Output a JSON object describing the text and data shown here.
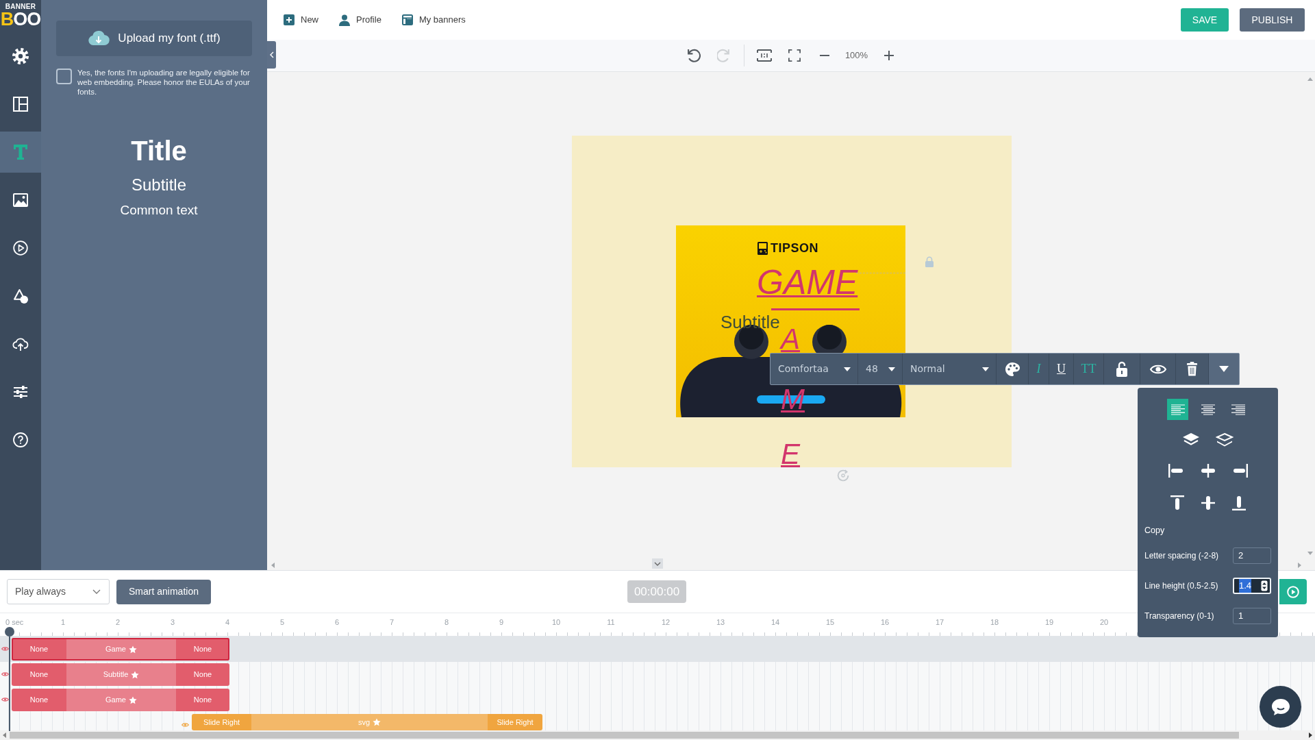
{
  "logo": {
    "top": "BANNER",
    "bottom": "BOO"
  },
  "sidebar": {
    "items": [
      {
        "kind": "settings",
        "selected": false
      },
      {
        "kind": "layout",
        "selected": false
      },
      {
        "kind": "text",
        "selected": true
      },
      {
        "kind": "image",
        "selected": false
      },
      {
        "kind": "video",
        "selected": false
      },
      {
        "kind": "shapes",
        "selected": false
      },
      {
        "kind": "upload",
        "selected": false
      },
      {
        "kind": "adjust",
        "selected": false
      },
      {
        "kind": "help",
        "selected": false
      }
    ]
  },
  "font_panel": {
    "upload_button": "Upload my font (.ttf)",
    "eula": {
      "checked": false,
      "label": "Yes, the fonts I'm uploading are legally eligible for web embedding. Please honor the EULAs of your fonts."
    },
    "presets": [
      {
        "kind": "title",
        "label": "Title"
      },
      {
        "kind": "subtitle",
        "label": "Subtitle"
      },
      {
        "kind": "common",
        "label": "Common text"
      }
    ]
  },
  "top_nav": {
    "links": [
      {
        "kind": "new",
        "label": "New"
      },
      {
        "kind": "profile",
        "label": "Profile"
      },
      {
        "kind": "banners",
        "label": "My banners"
      }
    ],
    "buttons": [
      {
        "kind": "save",
        "label": "SAVE"
      },
      {
        "kind": "publish",
        "label": "PUBLISH"
      }
    ]
  },
  "canvas_toolbar": {
    "history": [
      {
        "kind": "undo",
        "disabled": false
      },
      {
        "kind": "redo",
        "disabled": true
      }
    ],
    "view": [
      {
        "kind": "actual_size"
      },
      {
        "kind": "fullscreen"
      }
    ],
    "zoom": "100%"
  },
  "banner": {
    "brand": "TIPSON",
    "heading": "GAME",
    "heading_stacked": [
      "A",
      "M",
      "E"
    ],
    "subtitle": "Subtitle"
  },
  "text_toolbar": {
    "font": "Comfortaa",
    "size": "48",
    "weight": "Normal",
    "styles": [
      {
        "kind": "italic",
        "label": "I",
        "on": true
      },
      {
        "kind": "underline",
        "label": "U",
        "on": false
      },
      {
        "kind": "uppercase",
        "label": "TT",
        "on": true
      }
    ],
    "locked": false,
    "visible": true,
    "expanded": true
  },
  "text_options": {
    "alignment": [
      {
        "kind": "left",
        "selected": true
      },
      {
        "kind": "center",
        "selected": false
      },
      {
        "kind": "right",
        "selected": false
      }
    ],
    "copy": "Copy",
    "fields": [
      {
        "label": "Letter spacing (-2-8)",
        "value": "2",
        "focused": false
      },
      {
        "label": "Line height (0.5-2.5)",
        "value": "1.4",
        "focused": true
      },
      {
        "label": "Transparency (0-1)",
        "value": "1",
        "focused": false
      }
    ]
  },
  "timeline": {
    "play_mode": "Play always",
    "smart_button": "Smart animation",
    "time": "00:00:00",
    "ruler": [
      "0 sec",
      "1",
      "2",
      "3",
      "4",
      "5",
      "6",
      "7",
      "8",
      "9",
      "10",
      "11",
      "12",
      "13",
      "14",
      "15",
      "16",
      "17",
      "18",
      "19",
      "20"
    ],
    "tracks": [
      {
        "selected": true,
        "color": "#e25d6c",
        "segments": [
          {
            "kind": "in",
            "label": "None"
          },
          {
            "kind": "main",
            "label": "Game"
          },
          {
            "kind": "out",
            "label": "None"
          }
        ]
      },
      {
        "selected": false,
        "color": "#e25d6c",
        "segments": [
          {
            "kind": "in",
            "label": "None"
          },
          {
            "kind": "main",
            "label": "Subtitle"
          },
          {
            "kind": "out",
            "label": "None"
          }
        ]
      },
      {
        "selected": false,
        "color": "#e25d6c",
        "segments": [
          {
            "kind": "in",
            "label": "None"
          },
          {
            "kind": "main",
            "label": "Game"
          },
          {
            "kind": "out",
            "label": "None"
          }
        ]
      },
      {
        "selected": false,
        "color": "#f0a53f",
        "segments": [
          {
            "kind": "in",
            "label": "Slide Right"
          },
          {
            "kind": "main",
            "label": "svg"
          },
          {
            "kind": "out",
            "label": "Slide Right"
          }
        ]
      }
    ]
  }
}
